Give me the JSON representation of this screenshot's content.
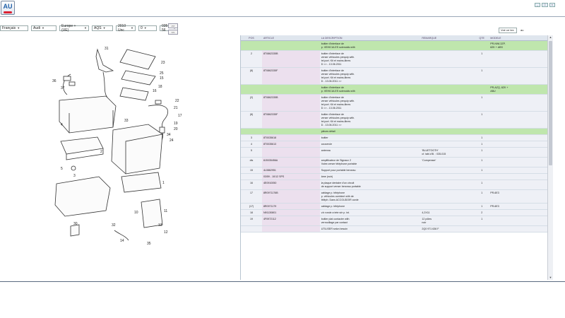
{
  "app": {
    "logo_text": "AU"
  },
  "window_controls": [
    "_",
    "□",
    "×"
  ],
  "filters": {
    "language": "Français",
    "brand": "Audi",
    "market": "Europe + (UE)",
    "model": "AQS",
    "year": "2010 Unc",
    "restriction": "0",
    "group": "035-56",
    "btn_next": ">>",
    "btn_prev": "<<"
  },
  "panel": {
    "search_label": "Voir ce tex",
    "search_value": "au",
    "headers": [
      "POS",
      "ARTICLE",
      "LA DESCRIPTION",
      "REMARQUE",
      "QTE",
      "MODELE"
    ],
    "rows": [
      {
        "pos": "",
        "ref": "",
        "desc": [
          "boitier d'interface de",
          "p. VEHICULES solenoids with"
        ],
        "rem": "",
        "qty": "",
        "mod": [
          "PR-NWL3ZP,",
          "8ZK + ABS"
        ],
        "green": true
      },
      {
        "pos": "2",
        "ref": "8T0862335B",
        "desc": [
          "boitier d'interface de",
          "verser véhicules prequip with.",
          "tel.port. Kit et mains-libres",
          "D >> - 13.06.2011"
        ],
        "rem": "",
        "qty": "1",
        "mod": [],
        "green": false
      },
      {
        "pos": "(8)",
        "ref": "8T0862335F",
        "desc": [
          "boitier d'interface de",
          "verser véhicules prequip with.",
          "tel.port. Kit et mains-libres",
          "D - 13.06.2011 >>"
        ],
        "rem": "",
        "qty": "1",
        "mod": [],
        "green": false
      },
      {
        "pos": "",
        "ref": "",
        "desc": [
          "boitier d'interface de",
          "p. VEHICULES solenoids with"
        ],
        "rem": "",
        "qty": "",
        "mod": [
          "PR-AZQ, 8ZK +",
          "ABU"
        ],
        "green": true
      },
      {
        "pos": "(2)",
        "ref": "8T0862335B",
        "desc": [
          "boitier d'interface de",
          "verser véhicules prequip with.",
          "tel.port. Kit et mains-libres",
          "D >> - 13.06.2011"
        ],
        "rem": "",
        "qty": "1",
        "mod": [],
        "green": false
      },
      {
        "pos": "(8)",
        "ref": "8T0862335F",
        "desc": [
          "boitier d'interface de",
          "verser véhicules prequip with.",
          "tel.port. Kit et mains-libres",
          "D - 13.06.2011 >>"
        ],
        "rem": "",
        "qty": "1",
        "mod": [],
        "green": false
      },
      {
        "pos": "",
        "ref": "",
        "desc": [
          "pièces détail"
        ],
        "rem": "",
        "qty": "",
        "mod": [],
        "green": true
      },
      {
        "pos": "3",
        "ref": "8T0035618",
        "desc": [
          "boitier"
        ],
        "rem": "",
        "qty": "1",
        "mod": [],
        "green": false
      },
      {
        "pos": "4",
        "ref": "8T0035613",
        "desc": [
          "couvercle"
        ],
        "rem": "",
        "qty": "1",
        "mod": [],
        "green": false
      },
      {
        "pos": "5",
        "ref": "",
        "desc": [
          "antenna"
        ],
        "rem": [
          "'BLUETOOTH'",
          "cf. tabl.d'ill. : 035-015"
        ],
        "qty": "1",
        "mod": [],
        "green": false
      },
      {
        "pos": "dis",
        "ref": "8J0035456A",
        "desc": [
          "amplificateur de Signaux 2",
          "Voies verser téléphone portable"
        ],
        "rem": [
          "'Compenser'"
        ],
        "qty": "1",
        "mod": [],
        "green": false
      },
      {
        "pos": "15",
        "ref": "4L0862951",
        "desc": [
          "Support pour portable berceau"
        ],
        "rem": "",
        "qty": "1",
        "mod": [],
        "green": false
      },
      {
        "pos": "",
        "ref": "03/59 - 10/12 SPS",
        "desc": [
          "âme (noir)"
        ],
        "rem": "",
        "qty": "",
        "mod": [],
        "green": false
      },
      {
        "pos": "16",
        "ref": "4E0910050",
        "desc": [
          "la plaque dentaire d'un circuit",
          "de support verser berceau portable"
        ],
        "rem": "",
        "qty": "1",
        "mod": [],
        "green": false
      },
      {
        "pos": "17",
        "ref": "8R0971176B",
        "desc": [
          "cablage p. téléphone",
          "p. véhicules combiné with de",
          "téléph. Dans ACCOUDOIR corde"
        ],
        "rem": "",
        "qty": "1",
        "mod": [
          "PR-6E3"
        ],
        "green": false
      },
      {
        "pos": "(17)",
        "ref": "8R0971179",
        "desc": [
          "cablage p. téléphone"
        ],
        "rem": "",
        "qty": "1",
        "mod": [
          "PR-6E3"
        ],
        "green": false
      },
      {
        "pos": "18",
        "ref": "N91130801",
        "desc": [
          "v.b ronde a tete s/e p. int."
        ],
        "rem": [
          "4,2X11"
        ],
        "qty": "2",
        "mod": [],
        "green": false
      },
      {
        "pos": "19",
        "ref": "4F0972112",
        "desc": [
          "boitier plat contacter with",
          "verrouillage par contact"
        ],
        "rem": [
          "12 pôles",
          "noir"
        ],
        "qty": "1",
        "mod": [],
        "green": false
      },
      {
        "pos": "",
        "ref": "",
        "desc": [
          "UTILISER selon besoin"
        ],
        "rem": [
          "2Q0 971 636 F"
        ],
        "qty": "",
        "mod": [],
        "green": false
      }
    ]
  },
  "diagram": {
    "callouts": [
      "31",
      "23",
      "25",
      "15",
      "36",
      "37",
      "16",
      "18",
      "22",
      "21",
      "17",
      "19",
      "20",
      "24",
      "4",
      "33",
      "34",
      "2",
      "3",
      "5",
      "1",
      "10",
      "11",
      "30",
      "12",
      "13",
      "32",
      "14",
      "35"
    ]
  }
}
